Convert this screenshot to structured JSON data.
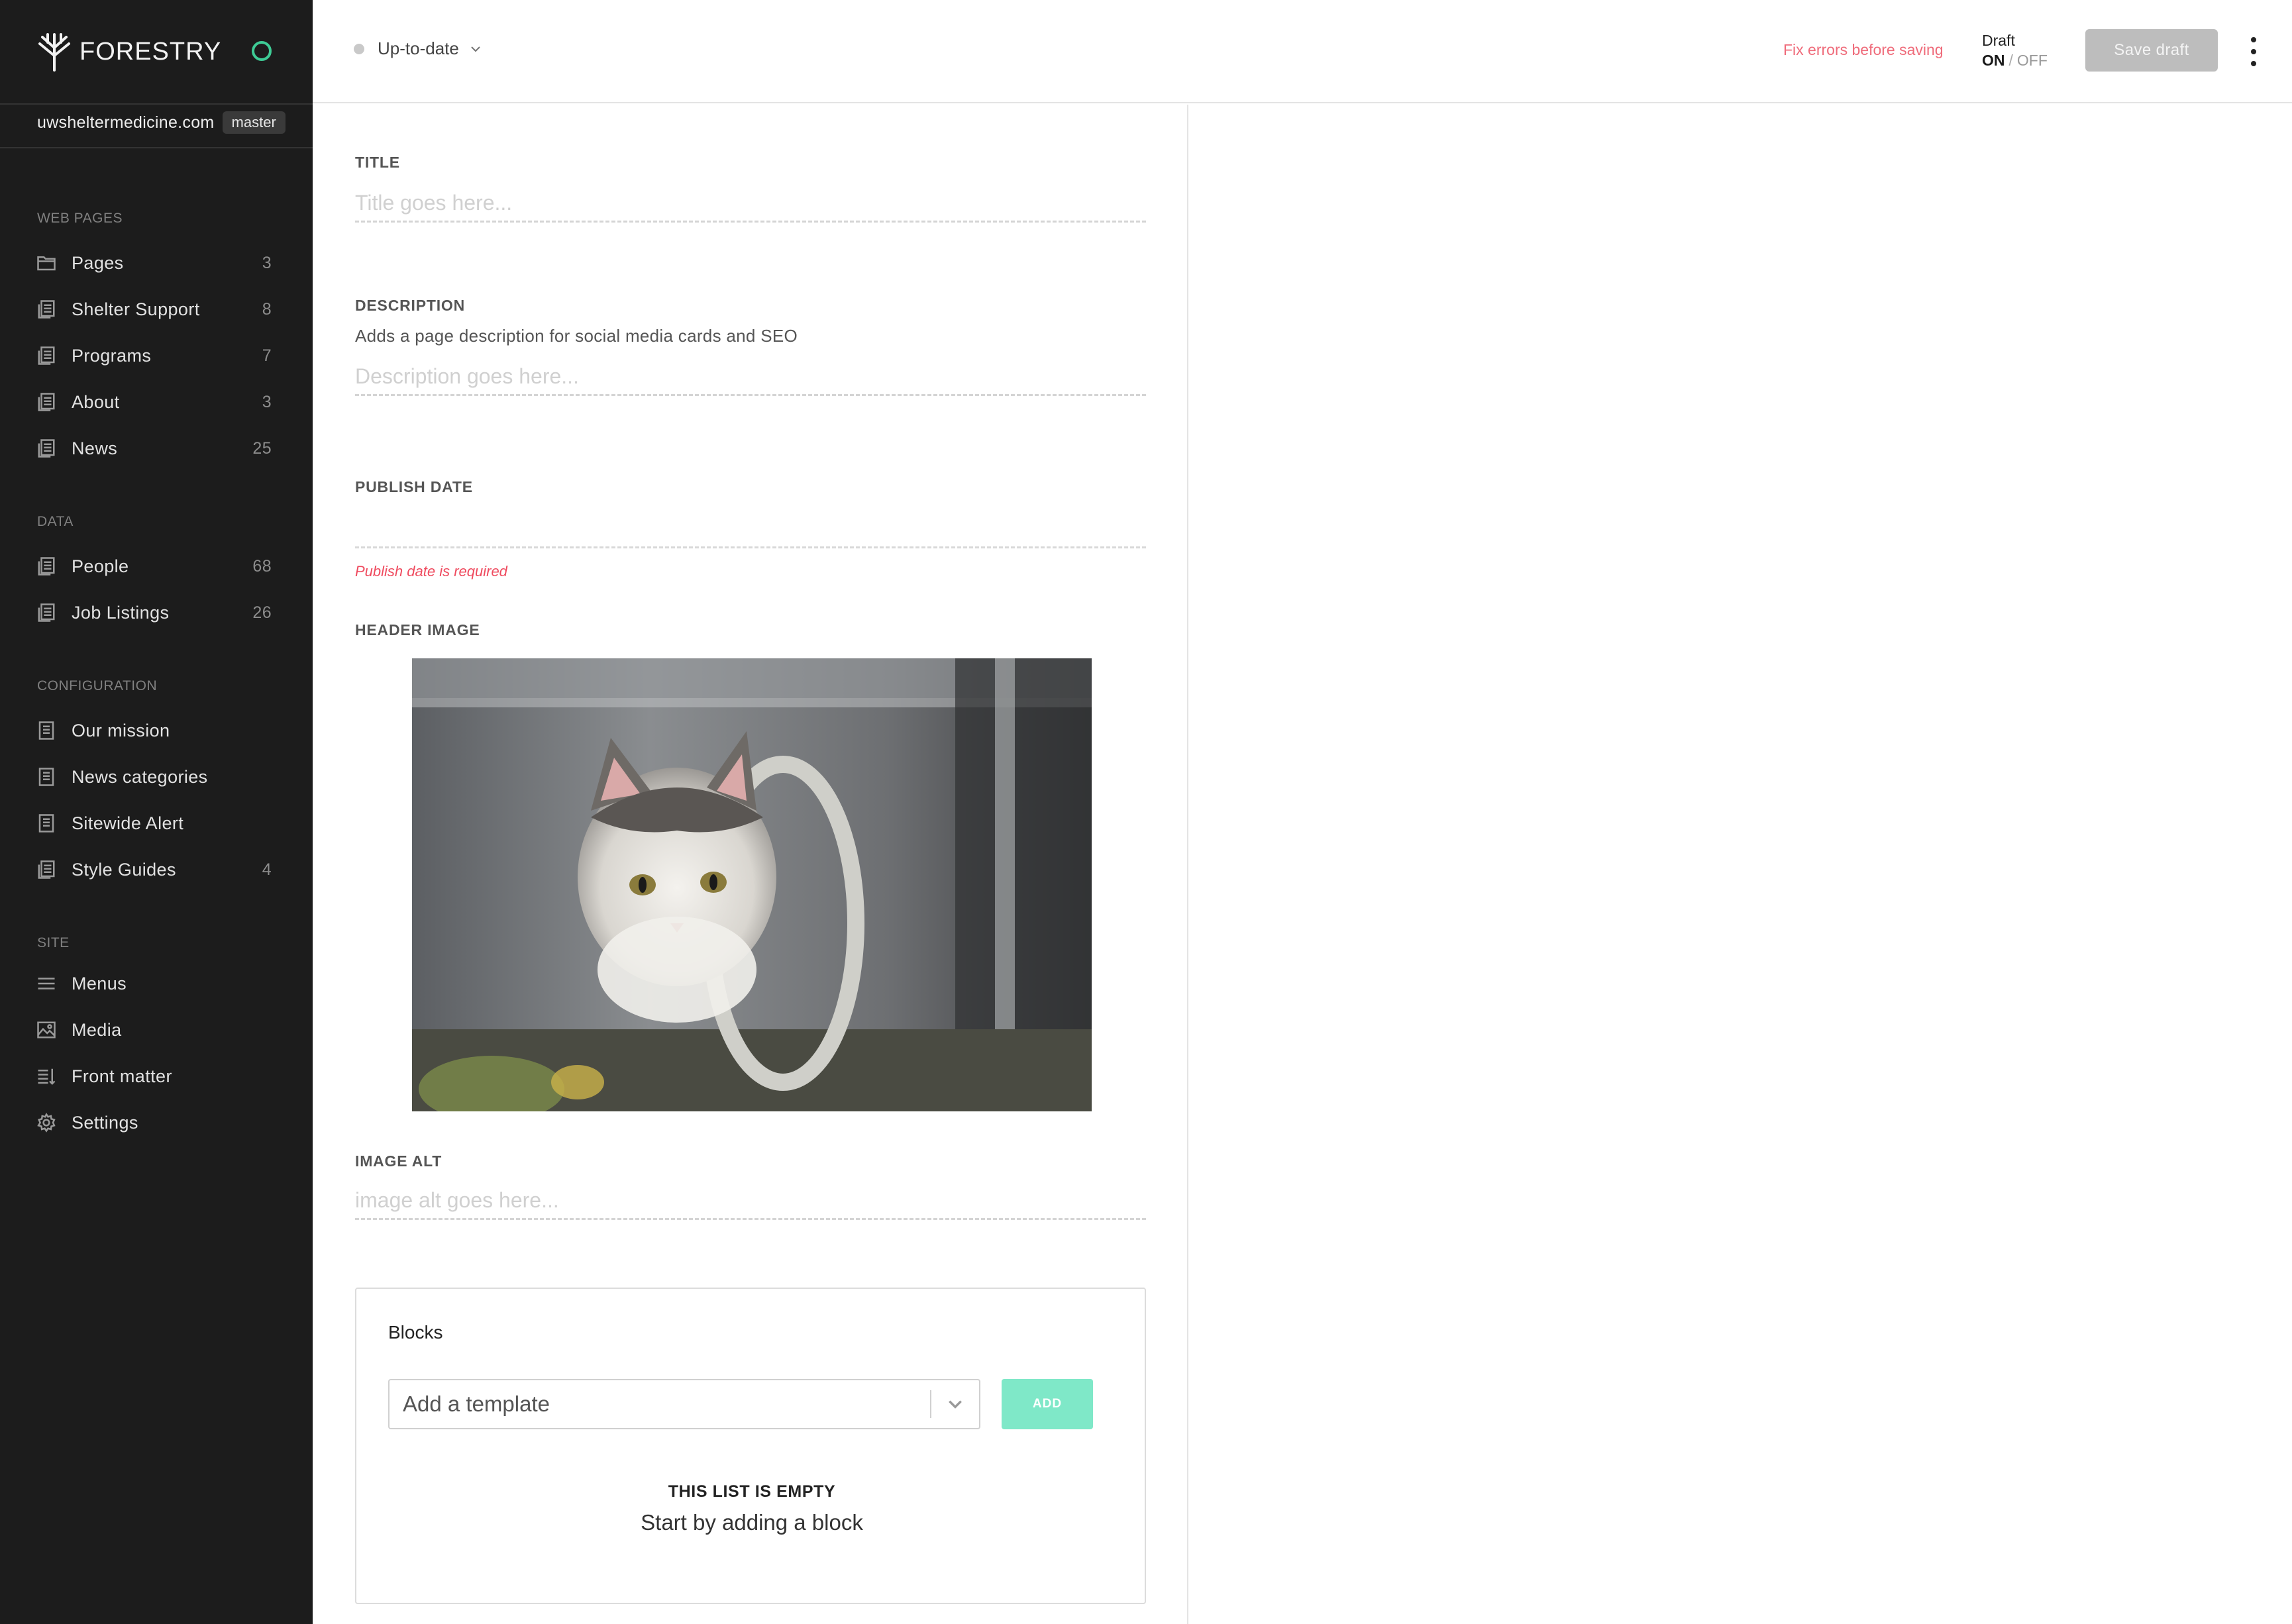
{
  "app": {
    "brand": "FORESTRY",
    "site_domain": "uwsheltermedicine.com",
    "branch": "master"
  },
  "sidebar": {
    "sections": [
      {
        "title": "WEB PAGES",
        "items": [
          {
            "label": "Pages",
            "count": "3",
            "icon": "folder-icon"
          },
          {
            "label": "Shelter Support",
            "count": "8",
            "icon": "documents-icon"
          },
          {
            "label": "Programs",
            "count": "7",
            "icon": "documents-icon"
          },
          {
            "label": "About",
            "count": "3",
            "icon": "documents-icon"
          },
          {
            "label": "News",
            "count": "25",
            "icon": "documents-icon"
          }
        ]
      },
      {
        "title": "DATA",
        "items": [
          {
            "label": "People",
            "count": "68",
            "icon": "documents-icon"
          },
          {
            "label": "Job Listings",
            "count": "26",
            "icon": "documents-icon"
          }
        ]
      },
      {
        "title": "CONFIGURATION",
        "items": [
          {
            "label": "Our mission",
            "count": "",
            "icon": "document-icon"
          },
          {
            "label": "News categories",
            "count": "",
            "icon": "document-icon"
          },
          {
            "label": "Sitewide Alert",
            "count": "",
            "icon": "document-icon"
          },
          {
            "label": "Style Guides",
            "count": "4",
            "icon": "documents-icon"
          }
        ]
      },
      {
        "title": "SITE",
        "items": [
          {
            "label": "Menus",
            "count": "",
            "icon": "menu-icon"
          },
          {
            "label": "Media",
            "count": "",
            "icon": "image-icon"
          },
          {
            "label": "Front matter",
            "count": "",
            "icon": "sort-list-icon"
          },
          {
            "label": "Settings",
            "count": "",
            "icon": "gear-icon"
          }
        ]
      }
    ]
  },
  "topbar": {
    "sync_status": "Up-to-date",
    "fix_errors": "Fix errors before saving",
    "draft_label": "Draft",
    "draft_on": "ON",
    "draft_sep": "/",
    "draft_off": "OFF",
    "save_label": "Save draft"
  },
  "form": {
    "title": {
      "label": "TITLE",
      "placeholder": "Title goes here..."
    },
    "description": {
      "label": "DESCRIPTION",
      "help": "Adds a page description for social media cards and SEO",
      "placeholder": "Description goes here..."
    },
    "publish_date": {
      "label": "PUBLISH DATE",
      "value": "",
      "error": "Publish date is required"
    },
    "header_image": {
      "label": "HEADER IMAGE"
    },
    "image_alt": {
      "label": "IMAGE ALT",
      "placeholder": "image alt goes here..."
    },
    "blocks": {
      "title": "Blocks",
      "select_placeholder": "Add a template",
      "add_label": "ADD",
      "empty_title": "THIS LIST IS EMPTY",
      "empty_sub": "Start by adding a block"
    }
  },
  "colors": {
    "sidebar_bg": "#1c1c1c",
    "accent": "#3ecb95",
    "error": "#ef4b5f",
    "add_button": "#7fe8c8",
    "save_disabled": "#bdbdbd"
  }
}
